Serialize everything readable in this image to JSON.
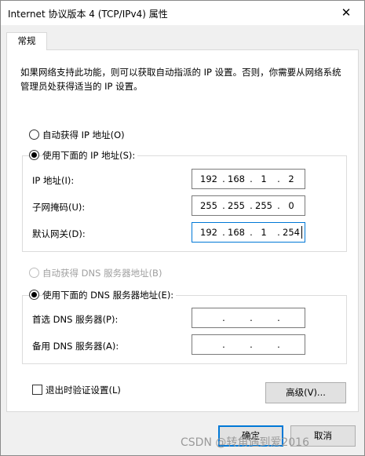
{
  "window": {
    "title": "Internet 协议版本 4 (TCP/IPv4) 属性",
    "close_glyph": "✕"
  },
  "tab": {
    "label": "常规"
  },
  "description": "如果网络支持此功能，则可以获取自动指派的 IP 设置。否则，你需要从网络系统管理员处获得适当的 IP 设置。",
  "ip": {
    "auto_label": "自动获得 IP 地址(O)",
    "manual_label": "使用下面的 IP 地址(S):",
    "selected": "manual",
    "address_label": "IP 地址(I):",
    "address": [
      "192",
      "168",
      "1",
      "2"
    ],
    "mask_label": "子网掩码(U):",
    "mask": [
      "255",
      "255",
      "255",
      "0"
    ],
    "gateway_label": "默认网关(D):",
    "gateway": [
      "192",
      "168",
      "1",
      "254"
    ]
  },
  "dns": {
    "auto_label": "自动获得 DNS 服务器地址(B)",
    "manual_label": "使用下面的 DNS 服务器地址(E):",
    "selected": "manual",
    "preferred_label": "首选 DNS 服务器(P):",
    "preferred": [
      "",
      "",
      "",
      ""
    ],
    "alternate_label": "备用 DNS 服务器(A):",
    "alternate": [
      "",
      "",
      "",
      ""
    ]
  },
  "validate_label": "退出时验证设置(L)",
  "advanced_label": "高级(V)...",
  "ok_label": "确定",
  "cancel_label": "取消",
  "ip_separator": ".",
  "watermark": "CSDN @转角遇到爱2016"
}
